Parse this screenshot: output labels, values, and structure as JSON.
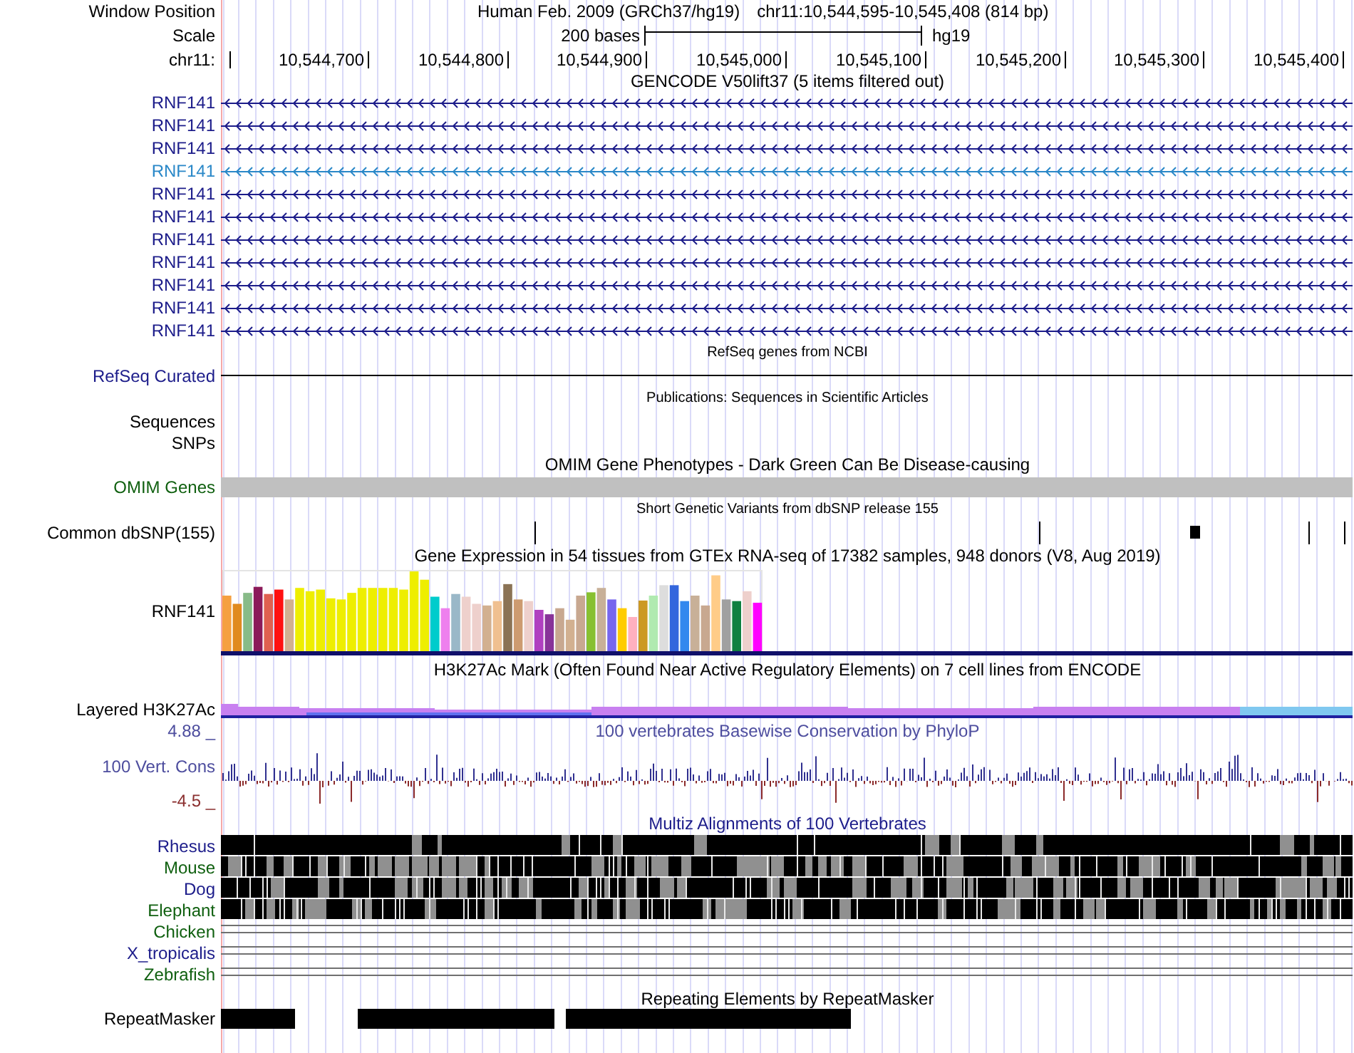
{
  "position": {
    "label": "Window Position",
    "assembly": "Human Feb. 2009 (GRCh37/hg19)",
    "range": "chr11:10,544,595-10,545,408 (814 bp)"
  },
  "scale": {
    "label": "Scale",
    "length": "200 bases",
    "db": "hg19"
  },
  "ruler": {
    "label": "chr11:",
    "ticks": [
      "10,544,700",
      "10,544,800",
      "10,544,900",
      "10,545,000",
      "10,545,100",
      "10,545,200",
      "10,545,300",
      "10,545,400"
    ]
  },
  "tracks": [
    {
      "kind": "genes",
      "title": "GENCODE V50lift37 (5 items filtered out)",
      "items": [
        {
          "name": "RNF141",
          "color": "#1c1c8a"
        },
        {
          "name": "RNF141",
          "color": "#1c1c8a"
        },
        {
          "name": "RNF141",
          "color": "#1c1c8a"
        },
        {
          "name": "RNF141",
          "color": "#2a88c8"
        },
        {
          "name": "RNF141",
          "color": "#1c1c8a"
        },
        {
          "name": "RNF141",
          "color": "#1c1c8a"
        },
        {
          "name": "RNF141",
          "color": "#1c1c8a"
        },
        {
          "name": "RNF141",
          "color": "#1c1c8a"
        },
        {
          "name": "RNF141",
          "color": "#1c1c8a"
        },
        {
          "name": "RNF141",
          "color": "#1c1c8a"
        },
        {
          "name": "RNF141",
          "color": "#1c1c8a"
        }
      ]
    },
    {
      "kind": "line",
      "title": "RefSeq genes from NCBI",
      "label": "RefSeq Curated"
    },
    {
      "kind": "empty",
      "title": "Publications: Sequences in Scientific Articles",
      "labels": [
        "Sequences",
        "SNPs"
      ]
    },
    {
      "kind": "bar",
      "title": "OMIM Gene Phenotypes - Dark Green Can Be Disease-causing",
      "label": "OMIM Genes"
    },
    {
      "kind": "variants",
      "title": "Short Genetic Variants from dbSNP release 155",
      "label": "Common dbSNP(155)"
    },
    {
      "kind": "expression",
      "title": "Gene Expression in 54 tissues from GTEx RNA-seq of 17382 samples, 948 donors (V8, Aug 2019)",
      "label": "RNF141"
    },
    {
      "kind": "signal",
      "title": "H3K27Ac Mark (Often Found Near Active Regulatory Elements) on 7 cell lines from ENCODE",
      "label": "Layered H3K27Ac"
    },
    {
      "kind": "wiggle",
      "title": "100 vertebrates Basewise Conservation by PhyloP",
      "label": "100 Vert. Cons",
      "max": "4.88 _",
      "min": "-4.5 _"
    },
    {
      "kind": "alignment",
      "title": "Multiz Alignments of 100 Vertebrates",
      "species": [
        {
          "name": "Rhesus",
          "color": "#1c1c8a",
          "kind": "blocks"
        },
        {
          "name": "Mouse",
          "color": "#106010",
          "kind": "blocks"
        },
        {
          "name": "Dog",
          "color": "#1c1c8a",
          "kind": "blocks"
        },
        {
          "name": "Elephant",
          "color": "#106010",
          "kind": "blocks"
        },
        {
          "name": "Chicken",
          "color": "#106010",
          "kind": "lines"
        },
        {
          "name": "X_tropicalis",
          "color": "#1c1c8a",
          "kind": "lines"
        },
        {
          "name": "Zebrafish",
          "color": "#106010",
          "kind": "lines"
        }
      ]
    },
    {
      "kind": "repeats",
      "title": "Repeating Elements by RepeatMasker",
      "label": "RepeatMasker"
    }
  ]
}
